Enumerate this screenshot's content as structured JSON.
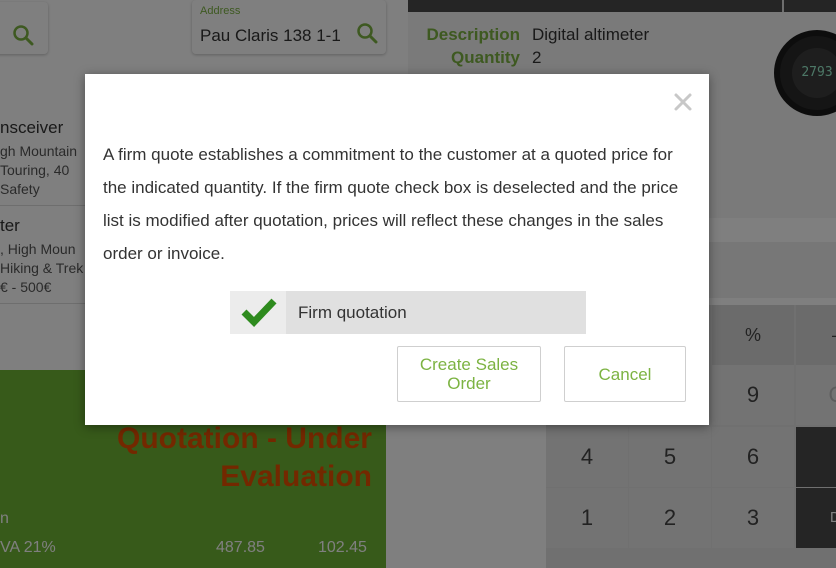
{
  "background": {
    "left": {
      "search_address": {
        "label": "Address",
        "value": "Pau Claris 138 1-1"
      },
      "products": [
        {
          "name": "nsceiver",
          "lines": [
            "gh Mountain",
            "Touring, 40",
            " Safety"
          ]
        },
        {
          "name": "ter",
          "lines": [
            ", High Moun",
            "Hiking & Trek",
            "€ - 500€"
          ]
        }
      ],
      "order": {
        "status": "Quotation - Under Evaluation",
        "line_label": "n",
        "tax_label": "VA 21%",
        "tax_base": "487.85",
        "tax_amount": "102.45"
      }
    },
    "right": {
      "description_label": "Description",
      "description_value": "Digital altimeter",
      "quantity_label": "Quantity",
      "quantity_value": "2",
      "watch_display": "2793",
      "keypad": {
        "header_keys": [
          "%",
          "–"
        ],
        "row1": [
          "9",
          "Q"
        ],
        "row2": [
          "4",
          "5",
          "6"
        ],
        "row3": [
          "1",
          "2",
          "3",
          "Di"
        ]
      }
    }
  },
  "modal": {
    "message": "A firm quote establishes a commitment to the customer at a quoted price for the indicated quantity. If the firm quote check box is deselected and the price list is modified after quotation, prices will reflect these changes in the sales order or invoice.",
    "checkbox_label": "Firm quotation",
    "checkbox_checked": true,
    "create_button_label": "Create Sales Order",
    "cancel_button_label": "Cancel",
    "close_icon": "close-icon",
    "accent_color": "#7cb342",
    "check_color": "#2e8b1e"
  }
}
